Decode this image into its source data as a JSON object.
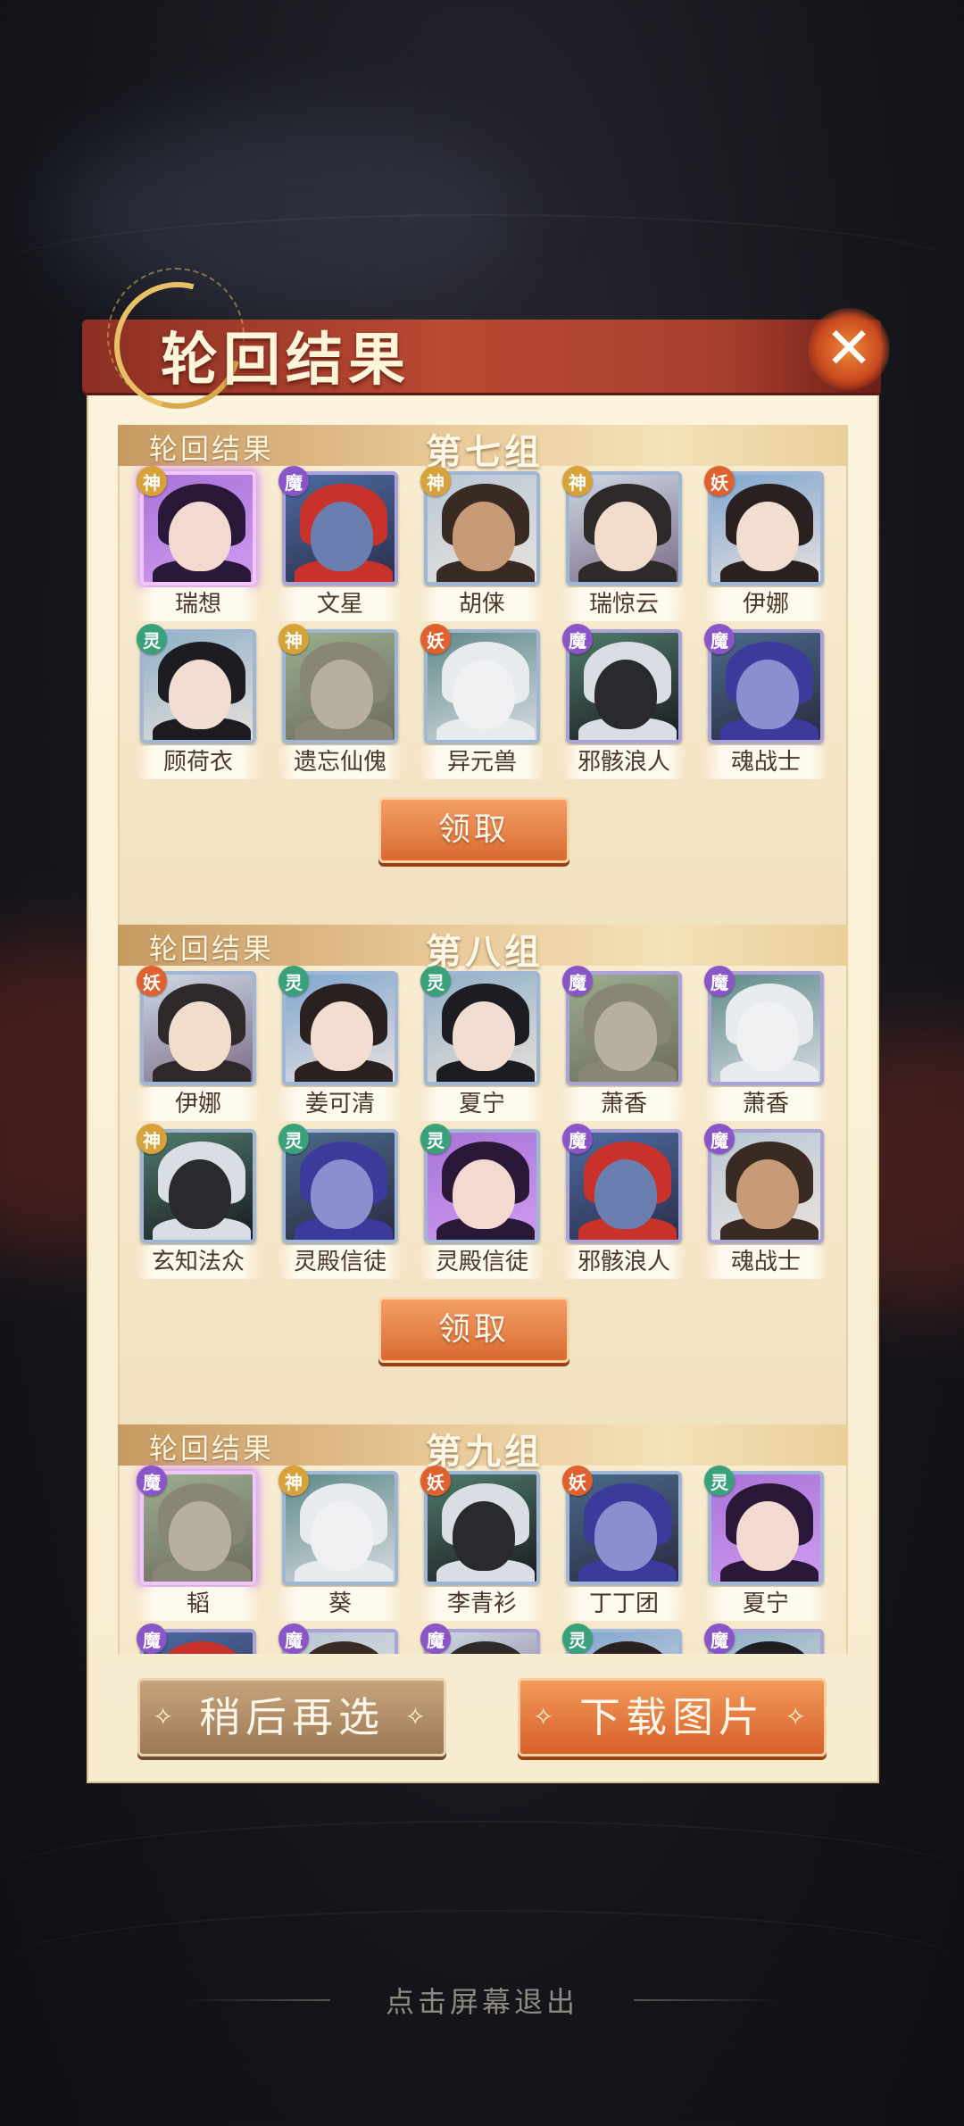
{
  "dialog": {
    "title": "轮回结果",
    "close_icon": "close-icon"
  },
  "groups": [
    {
      "subtitle": "轮回结果",
      "title": "第七组",
      "claim_label": "领取",
      "heroes": [
        {
          "name": "瑞想",
          "badge": "神",
          "badge_color": "#d8a23a",
          "selected": true
        },
        {
          "name": "文星",
          "badge": "魔",
          "badge_color": "#8a55c8"
        },
        {
          "name": "胡俫",
          "badge": "神",
          "badge_color": "#d8a23a"
        },
        {
          "name": "瑞惊云",
          "badge": "神",
          "badge_color": "#d8a23a"
        },
        {
          "name": "伊娜",
          "badge": "妖",
          "badge_color": "#e0602e"
        },
        {
          "name": "顾荷衣",
          "badge": "灵",
          "badge_color": "#3aa27a"
        },
        {
          "name": "遗忘仙傀",
          "badge": "神",
          "badge_color": "#d8a23a"
        },
        {
          "name": "异元兽",
          "badge": "妖",
          "badge_color": "#e0602e"
        },
        {
          "name": "邪骸浪人",
          "badge": "魔",
          "badge_color": "#8a55c8"
        },
        {
          "name": "魂战士",
          "badge": "魔",
          "badge_color": "#8a55c8"
        }
      ]
    },
    {
      "subtitle": "轮回结果",
      "title": "第八组",
      "claim_label": "领取",
      "heroes": [
        {
          "name": "伊娜",
          "badge": "妖",
          "badge_color": "#e0602e"
        },
        {
          "name": "姜可清",
          "badge": "灵",
          "badge_color": "#3aa27a"
        },
        {
          "name": "夏宁",
          "badge": "灵",
          "badge_color": "#3aa27a"
        },
        {
          "name": "萧香",
          "badge": "魔",
          "badge_color": "#8a55c8"
        },
        {
          "name": "萧香",
          "badge": "魔",
          "badge_color": "#8a55c8"
        },
        {
          "name": "玄知法众",
          "badge": "神",
          "badge_color": "#d8a23a"
        },
        {
          "name": "灵殿信徒",
          "badge": "灵",
          "badge_color": "#3aa27a"
        },
        {
          "name": "灵殿信徒",
          "badge": "灵",
          "badge_color": "#3aa27a"
        },
        {
          "name": "邪骸浪人",
          "badge": "魔",
          "badge_color": "#8a55c8"
        },
        {
          "name": "魂战士",
          "badge": "魔",
          "badge_color": "#8a55c8"
        }
      ]
    },
    {
      "subtitle": "轮回结果",
      "title": "第九组",
      "claim_label": "",
      "heroes": [
        {
          "name": "韬",
          "badge": "魔",
          "badge_color": "#8a55c8",
          "selected": true
        },
        {
          "name": "葵",
          "badge": "神",
          "badge_color": "#d8a23a"
        },
        {
          "name": "李青衫",
          "badge": "妖",
          "badge_color": "#e0602e"
        },
        {
          "name": "丁丁团",
          "badge": "妖",
          "badge_color": "#e0602e"
        },
        {
          "name": "夏宁",
          "badge": "灵",
          "badge_color": "#3aa27a"
        },
        {
          "name": "",
          "badge": "魔",
          "badge_color": "#8a55c8"
        },
        {
          "name": "",
          "badge": "魔",
          "badge_color": "#8a55c8"
        },
        {
          "name": "",
          "badge": "魔",
          "badge_color": "#8a55c8"
        },
        {
          "name": "",
          "badge": "灵",
          "badge_color": "#3aa27a"
        },
        {
          "name": "",
          "badge": "魔",
          "badge_color": "#8a55c8"
        }
      ]
    }
  ],
  "buttons": {
    "later": "稍后再选",
    "download": "下载图片",
    "deco": "✧"
  },
  "exit_hint": "点击屏幕退出"
}
